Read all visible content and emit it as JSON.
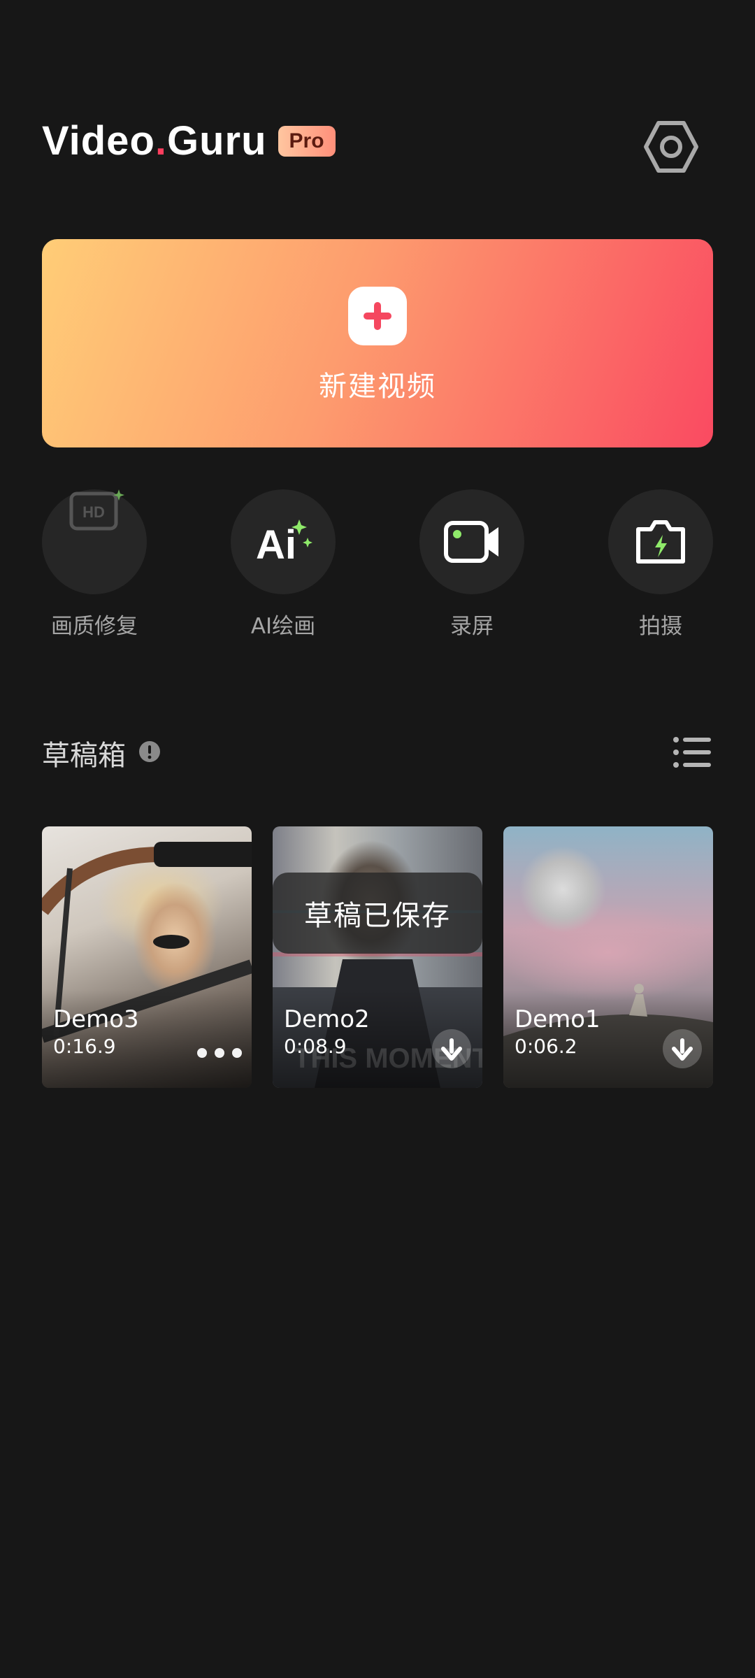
{
  "app": {
    "logo_main": "Video",
    "logo_dot": ".",
    "logo_tail": "Guru",
    "pro_badge": "Pro"
  },
  "new_video": {
    "label": "新建视频"
  },
  "tools": [
    {
      "label": "画质修复",
      "icon": "hd-repair-icon"
    },
    {
      "label": "AI绘画",
      "icon": "ai-paint-icon"
    },
    {
      "label": "录屏",
      "icon": "screen-record-icon"
    },
    {
      "label": "拍摄",
      "icon": "camera-icon"
    }
  ],
  "drafts": {
    "title": "草稿箱",
    "items": [
      {
        "name": "Demo3",
        "duration": "0:16.9",
        "action": "more"
      },
      {
        "name": "Demo2",
        "duration": "0:08.9",
        "action": "download"
      },
      {
        "name": "Demo1",
        "duration": "0:06.2",
        "action": "download"
      }
    ]
  },
  "toast": {
    "text": "草稿已保存"
  },
  "colors": {
    "background": "#171717",
    "gradient_start": "#ffcd77",
    "gradient_end": "#fa4a61",
    "plus_icon": "#f5475f",
    "accent_green": "#8fea6a"
  }
}
